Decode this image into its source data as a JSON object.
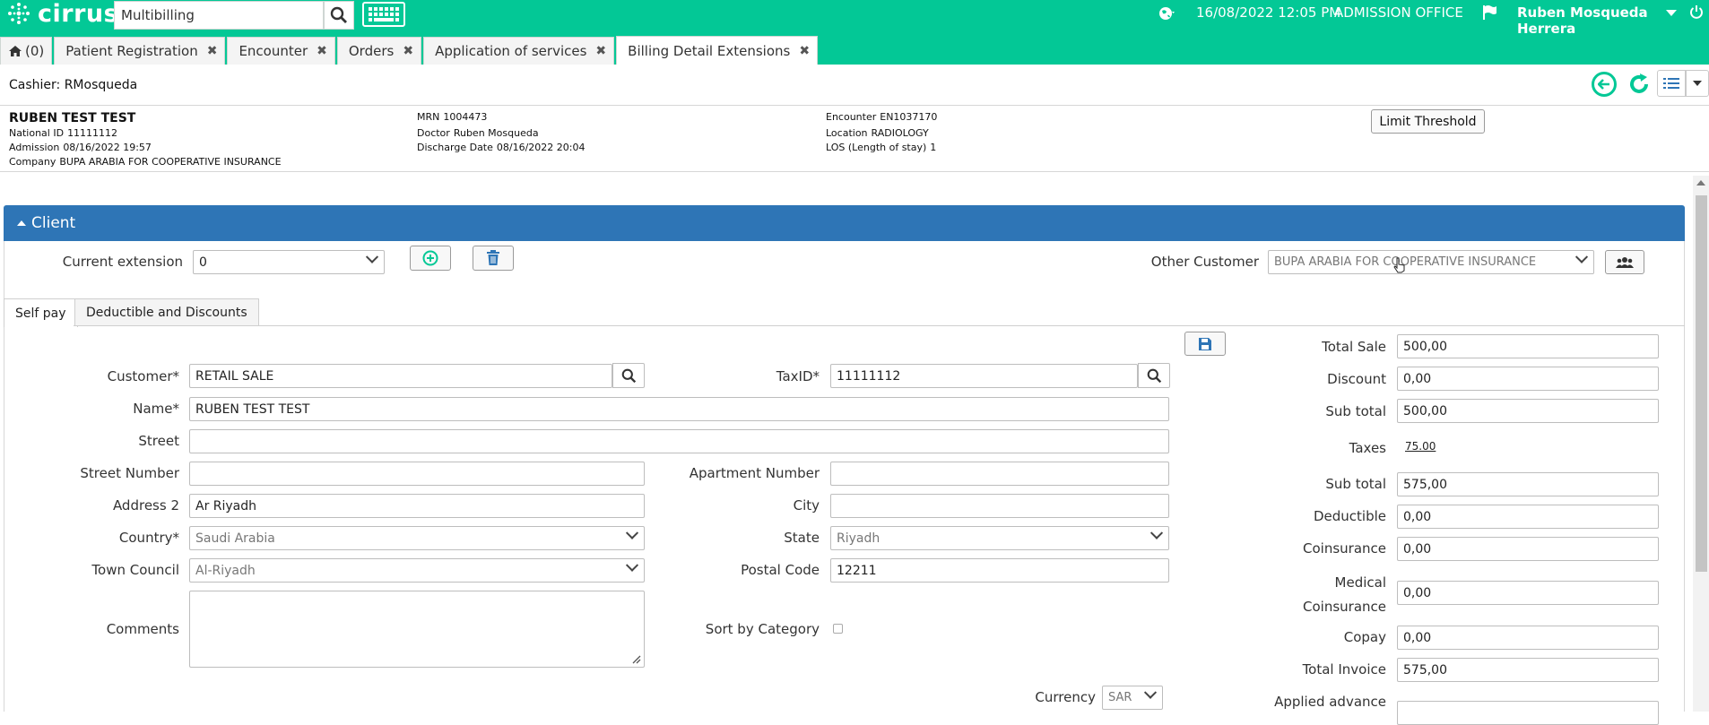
{
  "app": {
    "logo_text": "cirrus",
    "search_value": "Multibilling",
    "datetime": "16/08/2022 12:05 PM",
    "office": "ADMISSION OFFICE",
    "user": "Ruben Mosqueda Herrera"
  },
  "tabs": [
    {
      "label": "(0)"
    },
    {
      "label": "Patient Registration"
    },
    {
      "label": "Encounter"
    },
    {
      "label": "Orders"
    },
    {
      "label": "Application of services"
    },
    {
      "label": "Billing Detail Extensions"
    }
  ],
  "cashier": "Cashier: RMosqueda",
  "patient": {
    "name": "RUBEN TEST TEST",
    "national_id_label": "National ID",
    "national_id": "11111112",
    "admission_label": "Admission",
    "admission": "08/16/2022 19:57",
    "company_label": "Company",
    "company": "BUPA ARABIA FOR COOPERATIVE INSURANCE",
    "mrn_label": "MRN",
    "mrn": "1004473",
    "doctor_label": "Doctor",
    "doctor": "Ruben Mosqueda",
    "discharge_label": "Discharge Date",
    "discharge": "08/16/2022 20:04",
    "encounter_label": "Encounter",
    "encounter": "EN1037170",
    "location_label": "Location",
    "location": "RADIOLOGY",
    "los_label": "LOS (Length of stay)",
    "los": "1"
  },
  "limit_button": "Limit Threshold",
  "panel_title": "Client",
  "current_extension_label": "Current extension",
  "current_extension_value": "0",
  "other_customer_label": "Other Customer",
  "other_customer_value": "BUPA ARABIA FOR COOPERATIVE INSURANCE",
  "subtabs": [
    {
      "label": "Self pay"
    },
    {
      "label": "Deductible and Discounts"
    }
  ],
  "form": {
    "customer_label": "Customer*",
    "customer": "RETAIL SALE",
    "taxid_label": "TaxID*",
    "taxid": "11111112",
    "name_label": "Name*",
    "name": "RUBEN TEST TEST",
    "street_label": "Street",
    "street": "",
    "street_number_label": "Street Number",
    "street_number": "",
    "apartment_label": "Apartment Number",
    "apartment": "",
    "address2_label": "Address 2",
    "address2": "Ar Riyadh",
    "city_label": "City",
    "city": "",
    "country_label": "Country*",
    "country": "Saudi Arabia",
    "state_label": "State",
    "state": "Riyadh",
    "town_label": "Town Council",
    "town": "Al-Riyadh",
    "postal_label": "Postal Code",
    "postal": "12211",
    "comments_label": "Comments",
    "comments": "",
    "sort_label": "Sort by Category",
    "currency_label": "Currency",
    "currency": "SAR"
  },
  "totals": {
    "total_sale_label": "Total Sale",
    "total_sale": "500,00",
    "discount_label": "Discount",
    "discount": "0,00",
    "subtotal1_label": "Sub total",
    "subtotal1": "500,00",
    "taxes_label": "Taxes",
    "taxes": "75.00",
    "subtotal2_label": "Sub total",
    "subtotal2": "575,00",
    "deductible_label": "Deductible",
    "deductible": "0,00",
    "coinsurance_label": "Coinsurance",
    "coinsurance": "0,00",
    "medical_label_1": "Medical",
    "medical_label_2": "Coinsurance",
    "medical": "0,00",
    "copay_label": "Copay",
    "copay": "0,00",
    "total_invoice_label": "Total Invoice",
    "total_invoice": "575,00",
    "applied_advance_label": "Applied advance"
  },
  "colors": {
    "brand_green": "#03c896",
    "panel_blue": "#2e75b6"
  }
}
